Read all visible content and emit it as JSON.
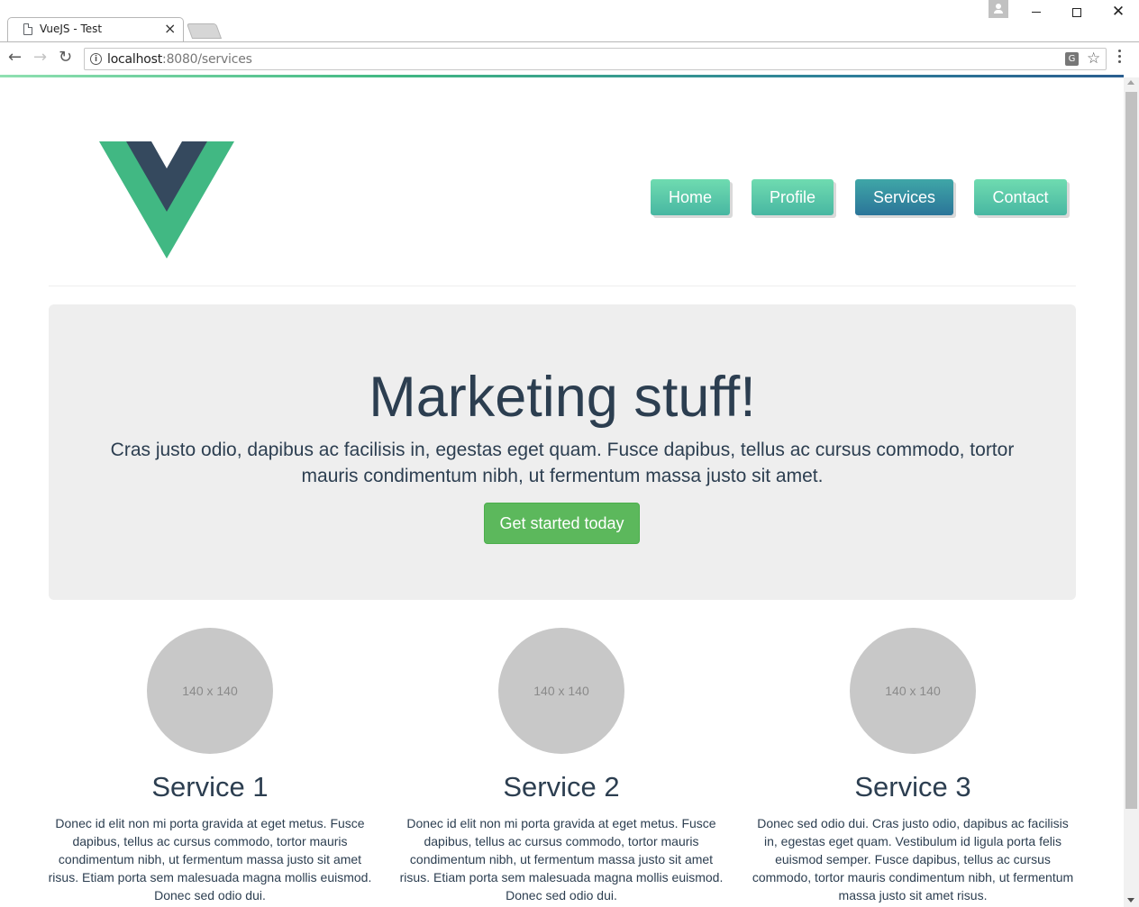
{
  "browser": {
    "tab_title": "VueJS - Test",
    "tab_close": "×",
    "url_host": "localhost",
    "url_path": ":8080/services",
    "info_glyph": "i",
    "back_glyph": "←",
    "forward_glyph": "→",
    "reload_glyph": "↻",
    "star_glyph": "☆",
    "close_glyph": "✕",
    "translate_glyph": "G"
  },
  "nav": {
    "items": [
      {
        "label": "Home",
        "active": false
      },
      {
        "label": "Profile",
        "active": false
      },
      {
        "label": "Services",
        "active": true
      },
      {
        "label": "Contact",
        "active": false
      }
    ]
  },
  "hero": {
    "title": "Marketing stuff!",
    "text": "Cras justo odio, dapibus ac facilisis in, egestas eget quam. Fusce dapibus, tellus ac cursus commodo, tortor mauris condimentum nibh, ut fermentum massa justo sit amet.",
    "button_label": "Get started today"
  },
  "services": [
    {
      "thumb_label": "140 x 140",
      "title": "Service 1",
      "text": "Donec id elit non mi porta gravida at eget metus. Fusce dapibus, tellus ac cursus commodo, tortor mauris condimentum nibh, ut fermentum massa justo sit amet risus. Etiam porta sem malesuada magna mollis euismod. Donec sed odio dui."
    },
    {
      "thumb_label": "140 x 140",
      "title": "Service 2",
      "text": "Donec id elit non mi porta gravida at eget metus. Fusce dapibus, tellus ac cursus commodo, tortor mauris condimentum nibh, ut fermentum massa justo sit amet risus. Etiam porta sem malesuada magna mollis euismod. Donec sed odio dui."
    },
    {
      "thumb_label": "140 x 140",
      "title": "Service 3",
      "text": "Donec sed odio dui. Cras justo odio, dapibus ac facilisis in, egestas eget quam. Vestibulum id ligula porta felis euismod semper. Fusce dapibus, tellus ac cursus commodo, tortor mauris condimentum nibh, ut fermentum massa justo sit amet risus."
    }
  ],
  "colors": {
    "vue_green": "#41b883",
    "vue_dark": "#35495e",
    "text": "#2c3e50",
    "cta_green": "#5cb85c",
    "jumbotron_bg": "#eeeeee"
  }
}
